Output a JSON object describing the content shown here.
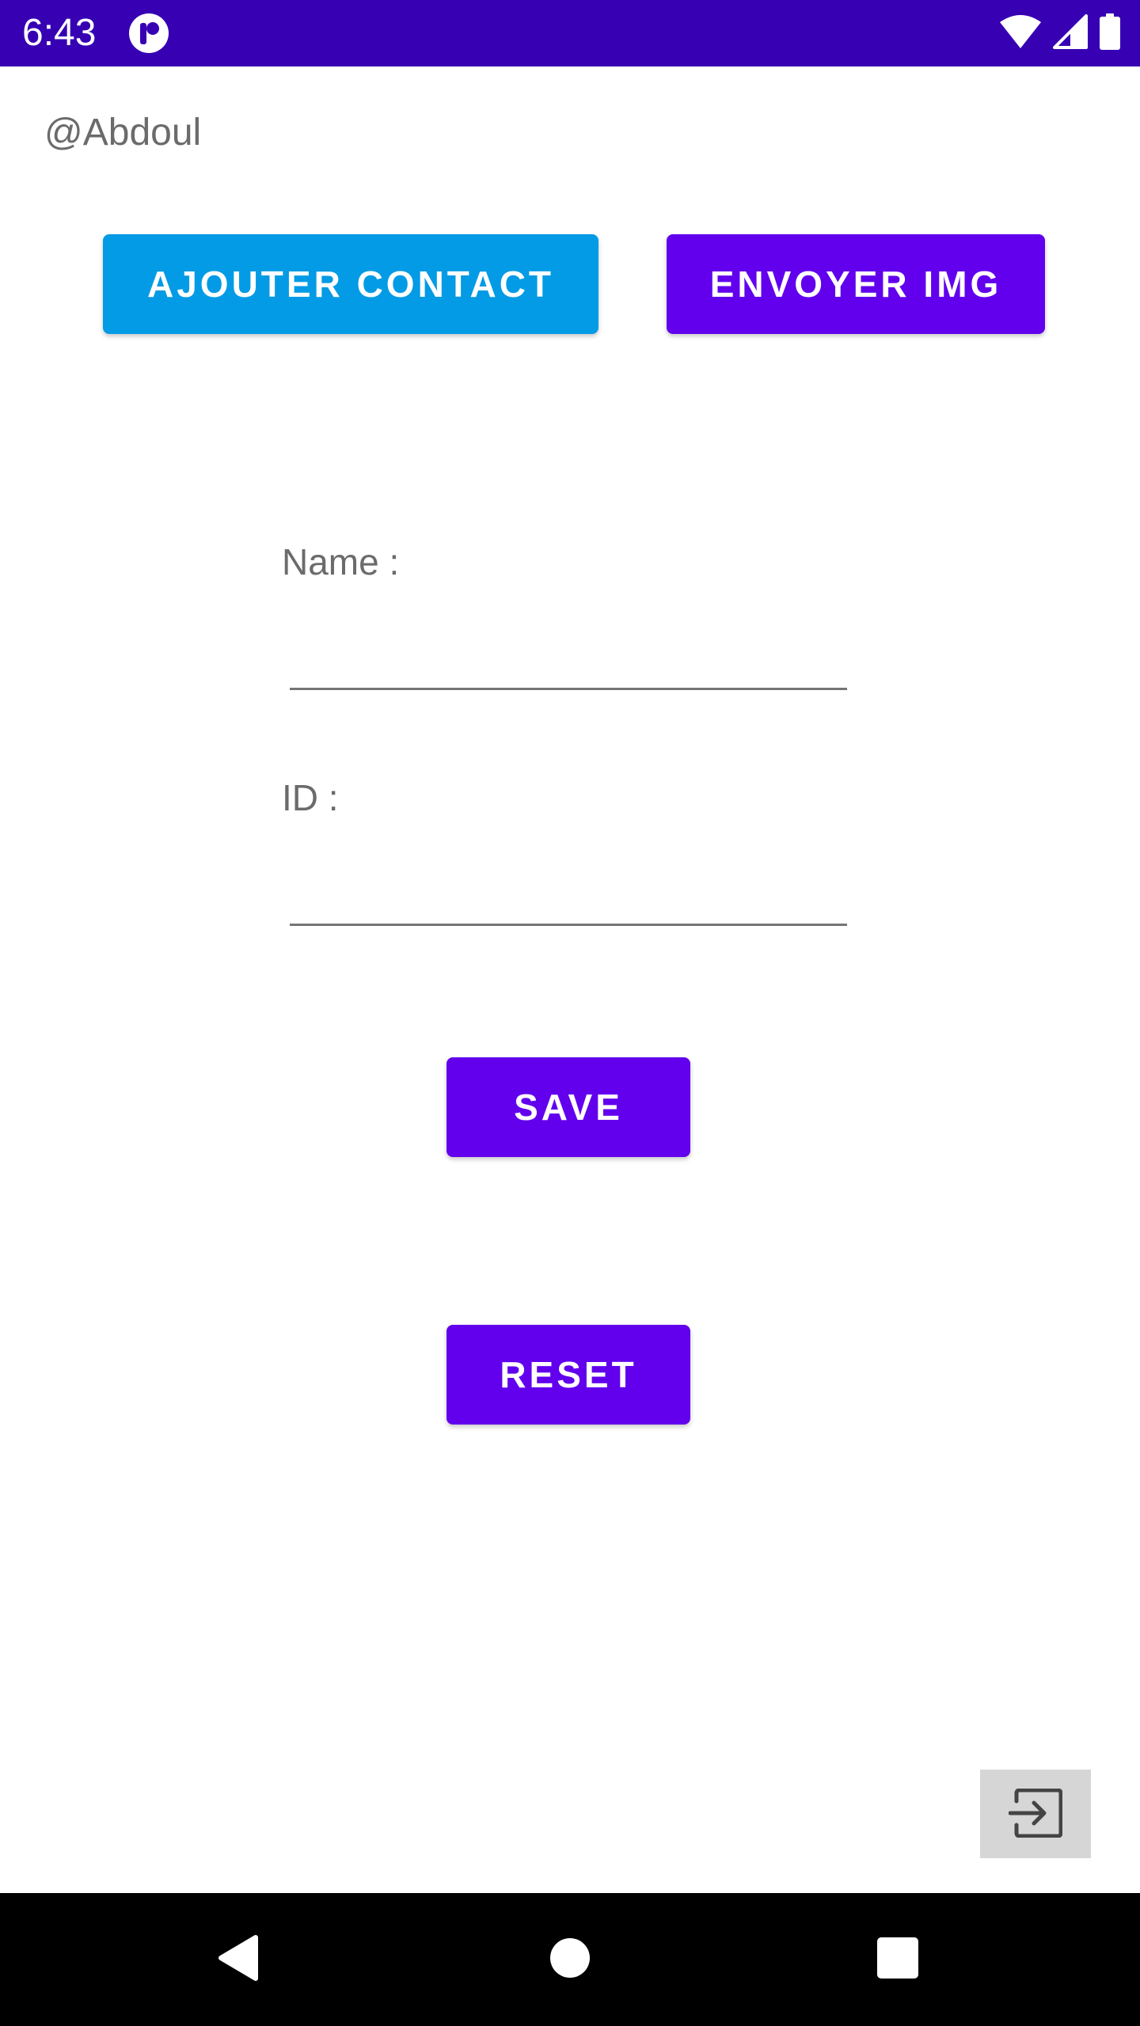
{
  "status_bar": {
    "time": "6:43",
    "background": "#3700b3",
    "icons": [
      "app-notification-icon",
      "wifi-icon",
      "cell-signal-icon",
      "battery-icon"
    ]
  },
  "header": {
    "username": "@Abdoul"
  },
  "actions": {
    "ajouter_contact_label": "AJOUTER CONTACT",
    "envoyer_img_label": "ENVOYER IMG",
    "ajouter_color": "#039be5",
    "primary_color": "#6200ee"
  },
  "form": {
    "name_label": "Name :",
    "name_value": "",
    "id_label": "ID :",
    "id_value": "",
    "save_label": "SAVE",
    "reset_label": "RESET"
  },
  "footer": {
    "logout_icon": "logout-icon"
  },
  "nav_bar": {
    "icons": [
      "back-icon",
      "home-icon",
      "recents-icon"
    ]
  }
}
